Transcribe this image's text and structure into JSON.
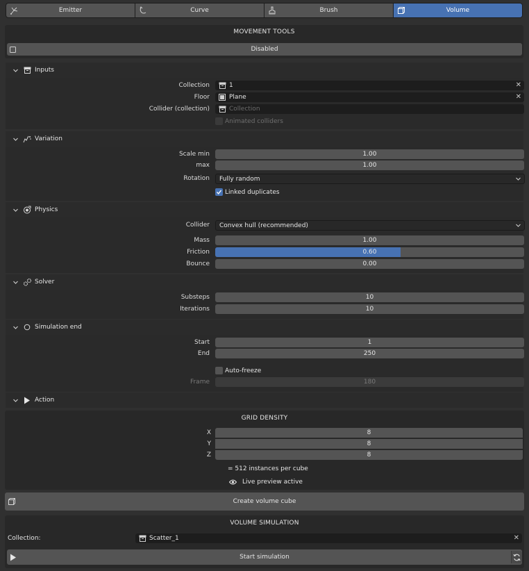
{
  "tabs": [
    {
      "label": "Emitter",
      "icon": "emitter-icon",
      "active": false
    },
    {
      "label": "Curve",
      "icon": "curve-icon",
      "active": false
    },
    {
      "label": "Brush",
      "icon": "brush-icon",
      "active": false
    },
    {
      "label": "Volume",
      "icon": "cube-icon",
      "active": true
    }
  ],
  "movement": {
    "title": "MOVEMENT TOOLS",
    "toggle_label": "Disabled",
    "toggle_checked": false
  },
  "inputs": {
    "header": "Inputs",
    "collection_label": "Collection",
    "collection_value": "1",
    "floor_label": "Floor",
    "floor_value": "Plane",
    "collider_label": "Collider (collection)",
    "collider_placeholder": "Collection",
    "animated_label": "Animated colliders",
    "animated_checked": false
  },
  "variation": {
    "header": "Variation",
    "scale_min_label": "Scale min",
    "scale_min_value": "1.00",
    "max_label": "max",
    "max_value": "1.00",
    "rotation_label": "Rotation",
    "rotation_value": "Fully random",
    "linked_label": "Linked duplicates",
    "linked_checked": true
  },
  "physics": {
    "header": "Physics",
    "collider_label": "Collider",
    "collider_value": "Convex hull (recommended)",
    "mass_label": "Mass",
    "mass_value": "1.00",
    "friction_label": "Friction",
    "friction_value": "0.60",
    "friction_fraction": 0.6,
    "bounce_label": "Bounce",
    "bounce_value": "0.00"
  },
  "solver": {
    "header": "Solver",
    "substeps_label": "Substeps",
    "substeps_value": "10",
    "iterations_label": "Iterations",
    "iterations_value": "10"
  },
  "simulation_end": {
    "header": "Simulation end",
    "start_label": "Start",
    "start_value": "1",
    "end_label": "End",
    "end_value": "250",
    "autofreeze_label": "Auto-freeze",
    "autofreeze_checked": false,
    "frame_label": "Frame",
    "frame_value": "180"
  },
  "action": {
    "header": "Action",
    "grid_title": "GRID DENSITY",
    "x_label": "X",
    "x_value": "8",
    "y_label": "Y",
    "y_value": "8",
    "z_label": "Z",
    "z_value": "8",
    "instances_text": "= 512 instances per cube",
    "preview_text": "Live preview active",
    "create_button": "Create volume cube"
  },
  "volume_sim": {
    "title": "VOLUME SIMULATION",
    "collection_label": "Collection:",
    "collection_value": "Scatter_1",
    "start_button": "Start simulation"
  },
  "colors": {
    "accent": "#4772b3",
    "background": "#303030",
    "field": "#545454"
  }
}
